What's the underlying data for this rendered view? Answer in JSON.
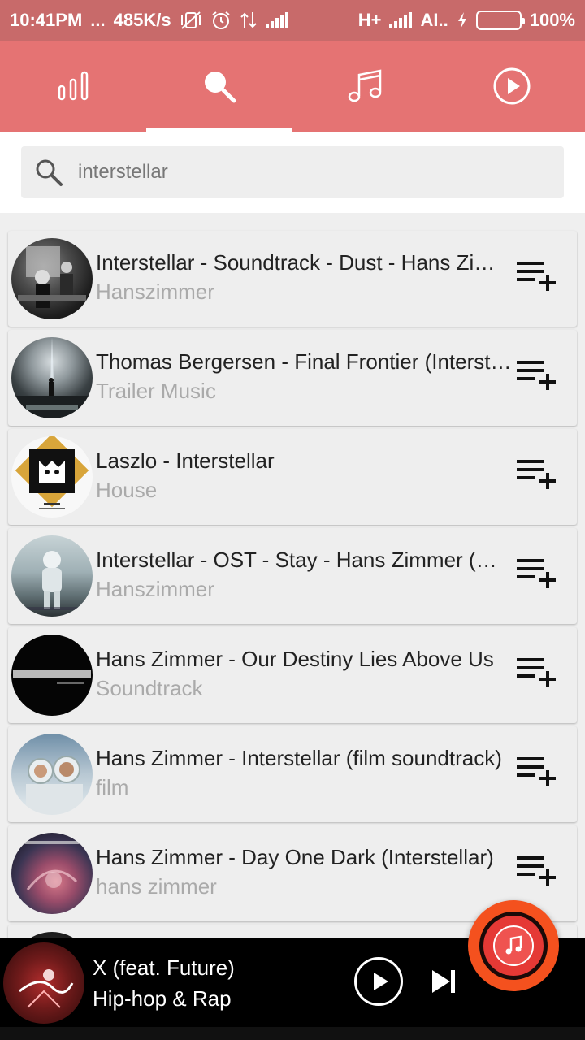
{
  "status_bar": {
    "time": "10:41PM",
    "dots": "...",
    "network_speed": "485K/s",
    "carrier_type": "H+",
    "carrier_name": "AI..",
    "battery_percent": "100%",
    "battery_level": 1.0
  },
  "tabs": [
    {
      "icon": "equalizer-icon",
      "active": false
    },
    {
      "icon": "search-icon",
      "active": true
    },
    {
      "icon": "music-note-icon",
      "active": false
    },
    {
      "icon": "play-circle-icon",
      "active": false
    }
  ],
  "search": {
    "value": "interstellar",
    "icon": "search-icon"
  },
  "results": [
    {
      "title": "Interstellar - Soundtrack - Dust - Hans Zimmer",
      "subtitle": "Hanszimmer"
    },
    {
      "title": "Thomas Bergersen - Final Frontier (Interstellar)",
      "subtitle": "Trailer Music"
    },
    {
      "title": "Laszlo - Interstellar",
      "subtitle": "House"
    },
    {
      "title": "Interstellar - OST - Stay - Hans Zimmer (HD)",
      "subtitle": "Hanszimmer"
    },
    {
      "title": "Hans Zimmer - Our Destiny Lies Above Us",
      "subtitle": "Soundtrack"
    },
    {
      "title": "Hans Zimmer -  Interstellar (film soundtrack)",
      "subtitle": "film"
    },
    {
      "title": "Hans Zimmer - Day One Dark (Interstellar)",
      "subtitle": "hans  zimmer"
    }
  ],
  "player": {
    "title": "X (feat. Future)",
    "subtitle": "Hip-hop & Rap"
  },
  "colors": {
    "status_bar": "#c86a6a",
    "tab_bar": "#e57373",
    "fab": "#f4511e",
    "player_bg": "#000000"
  }
}
